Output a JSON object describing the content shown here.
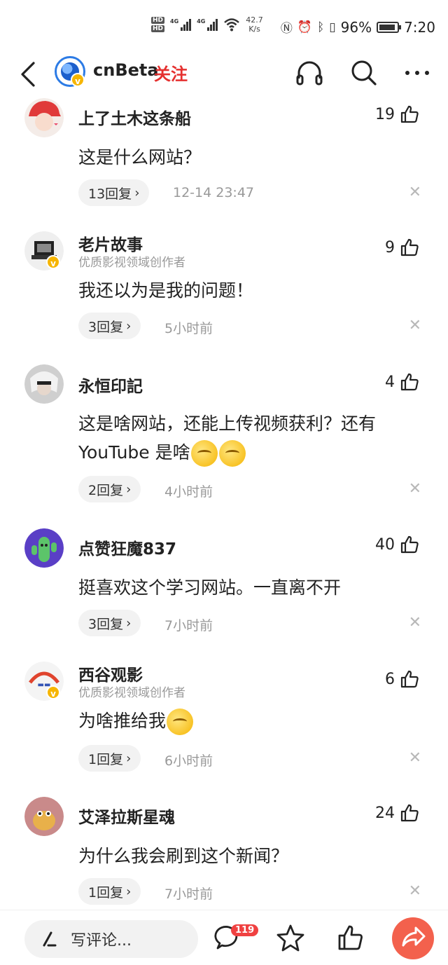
{
  "status_bar": {
    "hd1": "HD",
    "hd2": "HD",
    "net1": "4G",
    "net2": "4G",
    "speed_value": "42.7",
    "speed_unit": "K/s",
    "battery": "96%",
    "time": "7:20"
  },
  "header": {
    "title": "cnBeta",
    "follow_label": "关注"
  },
  "comments": [
    {
      "user": "上了土木这条船",
      "subtitle": "",
      "likes": "19",
      "text": "这是什么网站？",
      "replies": "13回复",
      "time": "12-14 23:47"
    },
    {
      "user": "老片故事",
      "subtitle": "优质影视领域创作者",
      "likes": "9",
      "text": "我还以为是我的问题！",
      "replies": "3回复",
      "time": "5小时前"
    },
    {
      "user": "永恒印記",
      "subtitle": "",
      "likes": "4",
      "text_line1": "这是啥网站，还能上传视频获利？还有",
      "text_line2": "YouTube 是啥",
      "replies": "2回复",
      "time": "4小时前"
    },
    {
      "user": "点赞狂魔837",
      "subtitle": "",
      "likes": "40",
      "text": "挺喜欢这个学习网站。一直离不开",
      "replies": "3回复",
      "time": "7小时前"
    },
    {
      "user": "西谷观影",
      "subtitle": "优质影视领域创作者",
      "likes": "6",
      "text": "为啥推给我",
      "replies": "1回复",
      "time": "6小时前"
    },
    {
      "user": "艾泽拉斯星魂",
      "subtitle": "",
      "likes": "24",
      "text": "为什么我会刷到这个新闻？",
      "replies": "1回复",
      "time": "7小时前"
    }
  ],
  "bottom_bar": {
    "compose_placeholder": "写评论...",
    "comment_count": "119"
  },
  "icons": {
    "back": "chevron-left-icon",
    "headphones": "headphones-icon",
    "search": "search-icon",
    "more": "more-icon",
    "like": "thumbs-up-icon",
    "close": "close-icon",
    "comment": "comment-bubble-icon",
    "star": "star-icon",
    "share": "share-icon"
  },
  "colors": {
    "follow": "#e5302f",
    "badge": "#f04141",
    "share": "#f3614d",
    "verified": "#f6b500"
  }
}
